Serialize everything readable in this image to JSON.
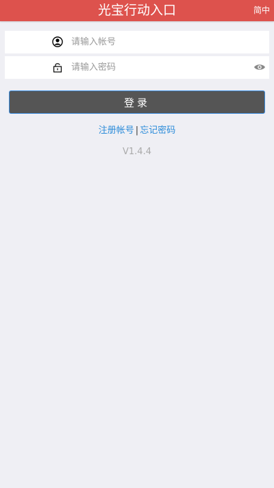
{
  "header": {
    "title": "光宝行动入口",
    "lang_label": "简中"
  },
  "login_form": {
    "username_placeholder": "请输入帐号",
    "password_placeholder": "请输入密码",
    "login_label": "登录"
  },
  "links": {
    "register": "注册帐号",
    "separator": "|",
    "forgot": "忘记密码"
  },
  "version": "V1.4.4",
  "icons": {
    "username": "user-icon",
    "password": "lock-icon",
    "toggle": "eye-icon"
  },
  "colors": {
    "header": "#dd524d",
    "background": "#efeff4",
    "button": "#555555",
    "link": "#2a8bd9"
  }
}
